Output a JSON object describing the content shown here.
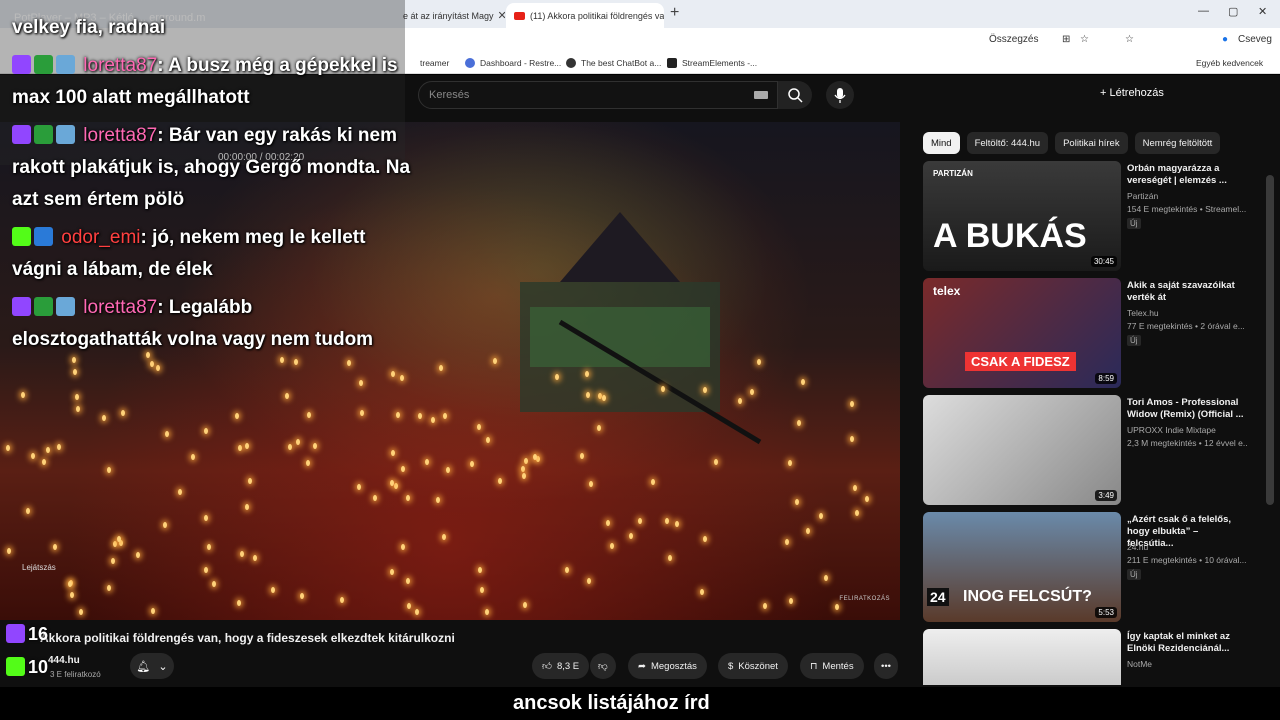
{
  "browser": {
    "tabs": [
      {
        "title": "e át az irányítást Magy"
      },
      {
        "title": "(11) Akkora politikai földrengés va"
      }
    ],
    "new_tab": "+",
    "window_controls": [
      "—",
      "▢",
      "✕"
    ],
    "toolbar": {
      "summary_label": "Összegzés",
      "profile_label": "Cseveg"
    },
    "bookmarks": [
      {
        "label": "treamer"
      },
      {
        "label": "Dashboard - Restre..."
      },
      {
        "label": "The best ChatBot a..."
      },
      {
        "label": "StreamElements -..."
      },
      {
        "label": "Egyéb kedvencek"
      }
    ]
  },
  "youtube": {
    "search_placeholder": "Keresés",
    "create_label": "Létrehozás",
    "video": {
      "title": "Akkora politikai földrengés van, hogy a fideszesek elkezdtek kitárulkozni",
      "channel": "444.hu",
      "subscribers": "3 E feliratkozó",
      "playing_label": "Lejátszás",
      "watermark": "FELIRATKOZÁS",
      "likes": "8,3 E",
      "share_label": "Megosztás",
      "thanks_label": "Köszönet",
      "save_label": "Mentés",
      "more_label": "•••"
    },
    "chips": [
      "Mind",
      "Feltöltő: 444.hu",
      "Politikai hírek",
      "Nemrég feltöltött"
    ],
    "recommendations": [
      {
        "title": "Orbán magyarázza a vereségét | elemzés ...",
        "channel": "Partizán",
        "meta": "154 E megtekintés • Streamel...",
        "badge": "Új",
        "duration": "30:45",
        "thumb_text": "A BUKÁS",
        "thumb_brand": "PARTIZÁN"
      },
      {
        "title": "Akik a saját szavazóikat verték át",
        "channel": "Telex.hu",
        "meta": "77 E megtekintés • 2 órával e...",
        "badge": "Új",
        "duration": "8:59",
        "thumb_text": "CSAK A FIDESZ",
        "thumb_brand": "telex"
      },
      {
        "title": "Tori Amos - Professional Widow (Remix) (Official ...",
        "channel": "UPROXX Indie Mixtape",
        "meta": "2,3 M megtekintés • 12 évvel e...",
        "badge": "",
        "duration": "3:49",
        "thumb_text": "",
        "thumb_brand": ""
      },
      {
        "title": "„Azért csak ő a felelős, hogy elbukta” – felcsútia...",
        "channel": "24.hu",
        "meta": "211 E megtekintés • 10 órával...",
        "badge": "Új",
        "duration": "5:53",
        "thumb_text": "INOG FELCSÚT?",
        "thumb_brand": "24"
      },
      {
        "title": "Így kaptak el minket az Elnöki Rezidenciánál...",
        "channel": "NotMe",
        "meta": "",
        "badge": "",
        "duration": "",
        "thumb_text": "",
        "thumb_brand": ""
      }
    ]
  },
  "player_overlay": {
    "title": "PotPlayer  –  MP3  –  Kétló ... erground.m",
    "time": "00:00:00 / 00:02:20"
  },
  "chat": {
    "lines": [
      {
        "user": "",
        "text": "velkey fia, radnai"
      },
      {
        "user": "loretta87",
        "text": ": A busz még a gépekkel is"
      },
      {
        "user": "",
        "text": "max 100 alatt megállhatott"
      },
      {
        "user": "loretta87",
        "text": ": Bár van egy rakás ki nem"
      },
      {
        "user": "",
        "text": "rakott plakátjuk is, ahogy Gergő mondta. Na"
      },
      {
        "user": "",
        "text": "azt sem értem pölö"
      },
      {
        "user": "odor_emi",
        "text": ": jó, nekem meg le kellett"
      },
      {
        "user": "",
        "text": "vágni a lábam, de élek"
      },
      {
        "user": "loretta87",
        "text": ": Legalább"
      },
      {
        "user": "",
        "text": "elosztogathatták volna vagy nem tudom"
      }
    ],
    "count_top": "16",
    "count_bottom": "10"
  },
  "subtitle": "ancsok listájához írd",
  "colors": {
    "loretta": "#ff69b4",
    "odor": "#ff4040",
    "twitch": "#9146ff"
  }
}
